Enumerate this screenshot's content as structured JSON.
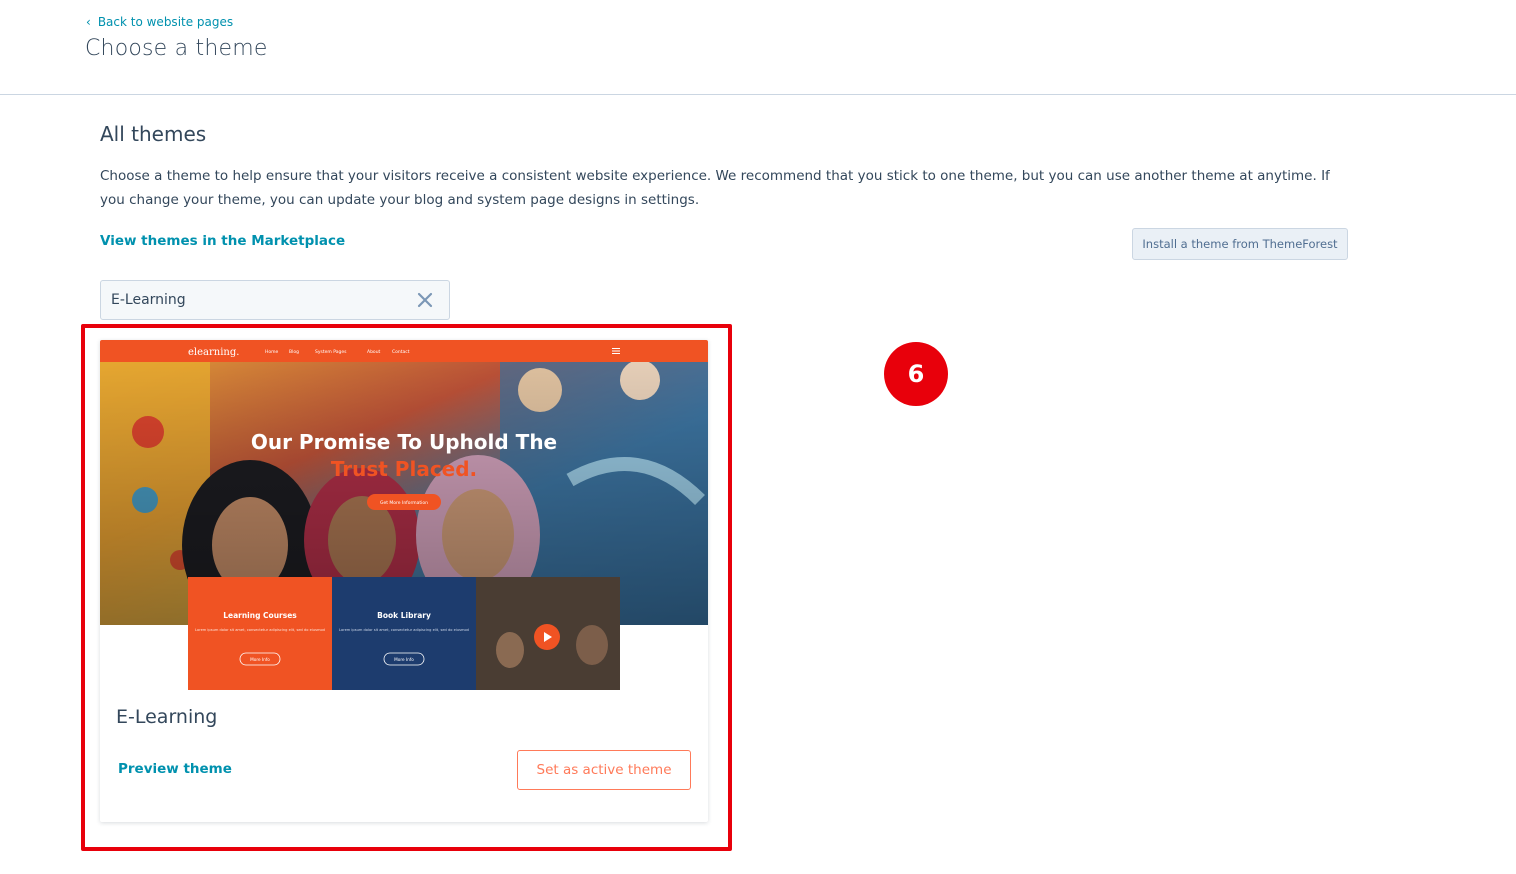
{
  "header": {
    "back_label": "Back to website pages",
    "title": "Choose a theme"
  },
  "section": {
    "title": "All themes",
    "description": "Choose a theme to help ensure that your visitors receive a consistent website experience. We recommend that you stick to one theme, but you can use another theme at anytime. If you change your theme, you can update your blog and system page designs in settings.",
    "marketplace_link": "View themes in the Marketplace",
    "install_button": "Install a theme from ThemeForest"
  },
  "search": {
    "value": "E-Learning"
  },
  "theme_card": {
    "name": "E-Learning",
    "preview_label": "Preview theme",
    "activate_label": "Set as active theme",
    "thumbnail": {
      "logo": "elearning.",
      "nav_items": [
        "Home",
        "Blog",
        "System Pages",
        "About",
        "Contact"
      ],
      "hero_line1": "Our Promise To Uphold The",
      "hero_line2": "Trust Placed.",
      "hero_button": "Get More Information",
      "tile1_title": "Learning Courses",
      "tile1_text": "Lorem ipsum dolor sit amet, consectetur adipiscing elit, sed do eiusmod",
      "tile1_btn": "More Info",
      "tile2_title": "Book Library",
      "tile2_text": "Lorem ipsum dolor sit amet, consectetur adipiscing elit, sed do eiusmod",
      "tile2_btn": "More Info"
    }
  },
  "annotation": {
    "step_number": "6"
  },
  "colors": {
    "link": "#0091ae",
    "text": "#33475b",
    "accent": "#ff7a59",
    "highlight": "#e8000b",
    "theme_orange": "#f05323",
    "theme_navy": "#1d3c6e"
  }
}
